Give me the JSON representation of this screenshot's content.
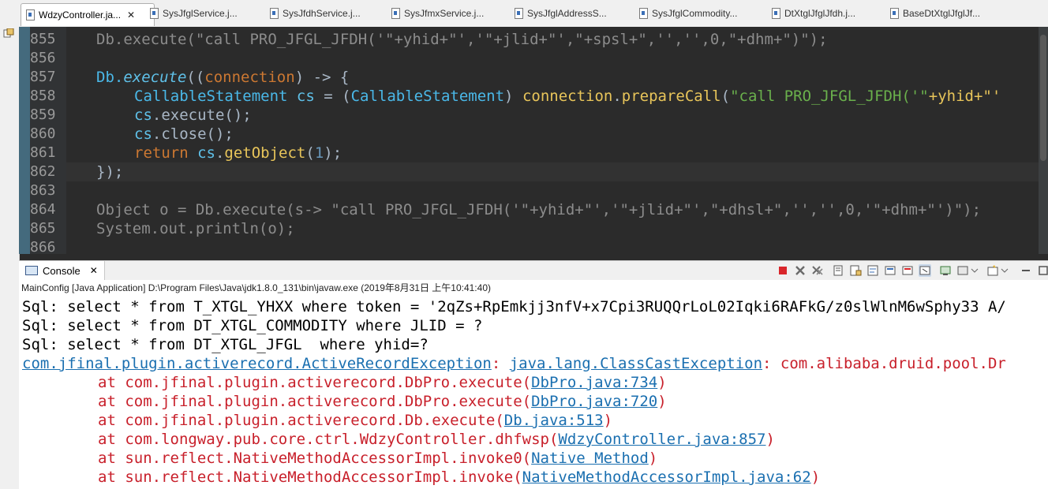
{
  "tabs": [
    {
      "label": "WdzyController.ja...",
      "active": true
    },
    {
      "label": "SysJfglService.j..."
    },
    {
      "label": "SysJfdhService.j..."
    },
    {
      "label": "SysJfmxService.j..."
    },
    {
      "label": "SysJfglAddressS..."
    },
    {
      "label": "SysJfglCommodity..."
    },
    {
      "label": "DtXtglJfglJfdh.j..."
    },
    {
      "label": "BaseDtXtglJfglJf..."
    }
  ],
  "editor": {
    "line_numbers": [
      "855",
      "856",
      "857",
      "858",
      "859",
      "860",
      "861",
      "862",
      "863",
      "864",
      "865",
      "866"
    ],
    "lines": {
      "l855": "Db.execute(\"call PRO_JFGL_JFDH('\"+yhid+\"','\"+jlid+\"',\"+spsl+\",'','',0,\"+dhm+\")\");",
      "l857_db": "Db.",
      "l857_exec": "execute",
      "l857_open": "((",
      "l857_conn": "connection",
      "l857_rest": ") -> {",
      "l858_type": "CallableStatement",
      "l858_cs": "cs",
      "l858_eq": " = (",
      "l858_type2": "CallableStatement",
      "l858_close": ") ",
      "l858_conn": "connection",
      "l858_dot": ".",
      "l858_call": "prepareCall",
      "l858_paren": "(",
      "l858_str": "\"call PRO_JFGL_JFDH('\"",
      "l858_plus": "+yhid+\"'",
      "l859_cs": "cs",
      "l859_m": ".execute();",
      "l860_cs": "cs",
      "l860_m": ".close();",
      "l861_ret": "return ",
      "l861_cs": "cs",
      "l861_dot": ".",
      "l861_m": "getObject",
      "l861_p1": "(",
      "l861_n": "1",
      "l861_p2": ");",
      "l862": "});",
      "l864": "Object o = Db.execute(s-> \"call PRO_JFGL_JFDH('\"+yhid+\"','\"+jlid+\"',\"+dhsl+\",'','',0,'\"+dhm+\"')\");",
      "l865": "System.out.println(o);"
    }
  },
  "console": {
    "tab_label": "Console",
    "tab_close": "✕",
    "status": "MainConfig [Java Application] D:\\Program Files\\Java\\jdk1.8.0_131\\bin\\javaw.exe (2019年8月31日 上午10:41:40)",
    "sql1": "Sql: select * from T_XTGL_YHXX where token = '2qZs+RpEmkjj3nfV+x7Cpi3RUQQrLoL02Iqki6RAFkG/z0slWlnM6wSphy33 A/",
    "sql2": "Sql: select * from DT_XTGL_COMMODITY where JLID = ?",
    "sql3": "Sql: select * from DT_XTGL_JFGL  where yhid=?",
    "exc_link1": "com.jfinal.plugin.activerecord.ActiveRecordException",
    "exc_sep1": ": ",
    "exc_link2": "java.lang.ClassCastException",
    "exc_sep2": ": com.alibaba.druid.pool.Dr",
    "trace": [
      {
        "at": "at com.jfinal.plugin.activerecord.DbPro.execute(",
        "link": "DbPro.java:734",
        "end": ")"
      },
      {
        "at": "at com.jfinal.plugin.activerecord.DbPro.execute(",
        "link": "DbPro.java:720",
        "end": ")"
      },
      {
        "at": "at com.jfinal.plugin.activerecord.Db.execute(",
        "link": "Db.java:513",
        "end": ")"
      },
      {
        "at": "at com.longway.pub.core.ctrl.WdzyController.dhfwsp(",
        "link": "WdzyController.java:857",
        "end": ")"
      },
      {
        "at": "at sun.reflect.NativeMethodAccessorImpl.invoke0(",
        "link": "Native Method",
        "end": ")"
      },
      {
        "at": "at sun.reflect.NativeMethodAccessorImpl.invoke(",
        "link": "NativeMethodAccessorImpl.java:62",
        "end": ")"
      }
    ]
  },
  "icons": {
    "terminate": "terminate-icon",
    "remove": "remove-launch-icon",
    "remove_all": "remove-all-icon",
    "scroll_lock": "scroll-lock-icon",
    "word_wrap": "word-wrap-icon",
    "pin": "pin-console-icon",
    "display": "display-console-icon",
    "new_console": "new-console-icon",
    "minimize": "minimize-icon",
    "maximize": "maximize-icon"
  },
  "colors": {
    "editor_bg": "#2b2b2b",
    "console_bg": "#ffffff",
    "error_red": "#c8202b",
    "link_blue": "#1a6fb0"
  }
}
